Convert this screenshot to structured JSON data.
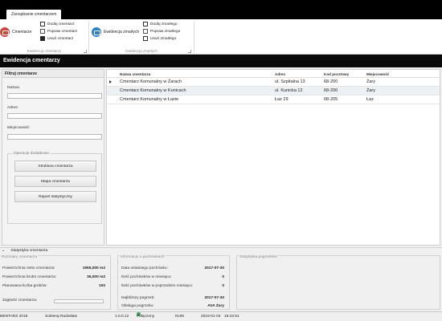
{
  "ribbon": {
    "active_tab": "Zarządzanie cmentarzem",
    "group1": {
      "label": "Ewidencja cmentarzy",
      "big_button": "Cmentarze",
      "actions": [
        "Dodaj cmentarz",
        "Popraw cmentarz",
        "Usuń cmentarz"
      ]
    },
    "group2": {
      "label": "Ewidencja zmarłych",
      "big_button": "Ewidencja zmarłych",
      "actions": [
        "Dodaj zmarłego",
        "Popraw zmarłego",
        "Usuń zmarłego"
      ]
    }
  },
  "page_title": "Ewidencja cmentarzy",
  "filter": {
    "title": "Filtruj cmentarze",
    "name_label": "Nazwa:",
    "address_label": "Adres:",
    "city_label": "Miejscowość:",
    "ops_legend": "Operacje dodatkowe",
    "ops": [
      "Struktura cmentarza",
      "Mapa cmentarza",
      "Raport statystyczny"
    ]
  },
  "grid": {
    "headers": [
      "Nazwa cmentarza",
      "Adres",
      "Kod pocztowy",
      "Miejscowość"
    ],
    "rows": [
      [
        "Cmentarz Komunalny w Żarach",
        "ul. Szpitalna 13",
        "68-200",
        "Żary"
      ],
      [
        "Cmentarz Komunalny w Kunicach",
        "ul. Kunicka 12",
        "68-200",
        "Żary"
      ],
      [
        "Cmentarz Komunalny w Łazie",
        "Łaz 29",
        "68-205",
        "Łaz"
      ]
    ]
  },
  "stats": {
    "header": "Statystyka cmentarza",
    "sizes": {
      "title": "Rozmiary cmentarza",
      "rows": [
        {
          "label": "Powierzchnia netto cmentarza:",
          "value": "1955,000 m2"
        },
        {
          "label": "Powierzchnia brutto cmentarza:",
          "value": "36,000 m2"
        },
        {
          "label": "Planowana liczba grobów:",
          "value": "100"
        }
      ],
      "occupancy_label": "Zajętość cmentarza:",
      "occupancy": 0
    },
    "burials": {
      "title": "Informacje o pochówkach",
      "rows": [
        {
          "label": "Data ostatniego pochówku:",
          "value": "2017-07-30"
        },
        {
          "label": "Ilość pochówków w miesiącu:",
          "value": "0"
        },
        {
          "label": "Ilość pochówków w poprzednim miesiącu:",
          "value": "0"
        },
        {
          "label": "Najbliższy pogrzeb:",
          "value": "2017-07-30"
        },
        {
          "label": "Obsługa pogrzebu:",
          "value": "AVA Żary"
        }
      ]
    },
    "graves": {
      "title": "Statystyka pogrzebów"
    }
  },
  "statusbar": {
    "product": "CMENTARZ 2018",
    "user": "Sobieraj Radosław",
    "version": "1.0.0.12",
    "connection": "Połączony",
    "num": "NUM",
    "date": "2019-01-04",
    "time": "18:42:51"
  },
  "colors": {
    "accent_red": "#d0473c",
    "accent_blue": "#2f7fc4",
    "title_bar": "#0a0a0a",
    "status_connected": "#3aa655"
  }
}
